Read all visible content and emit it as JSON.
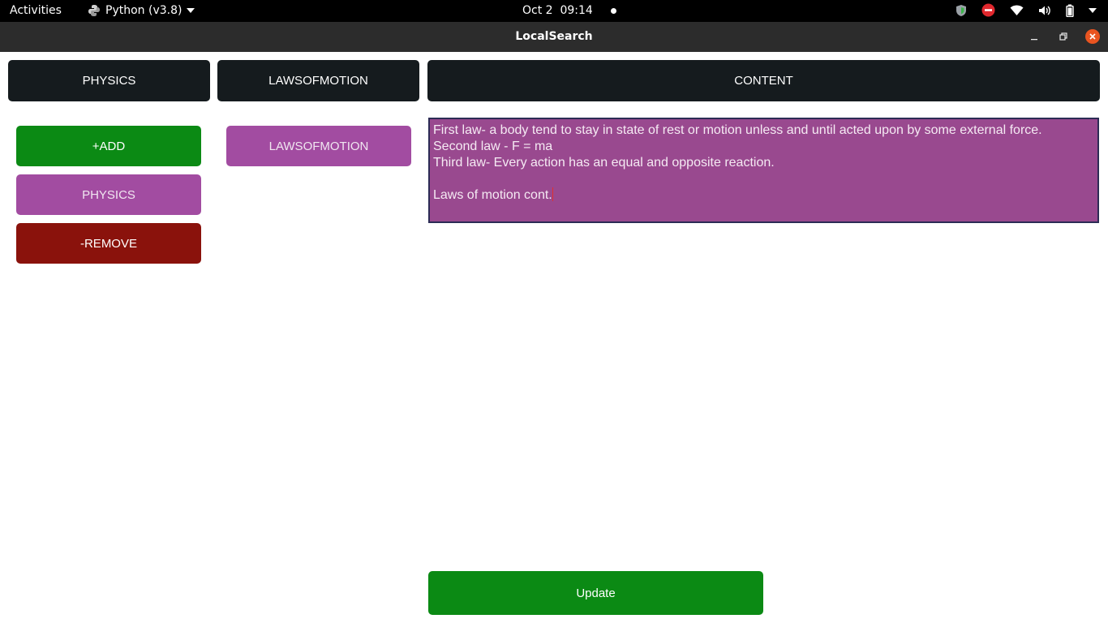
{
  "topbar": {
    "activities": "Activities",
    "app_menu": "Python (v3.8)",
    "date": "Oct 2",
    "time": "09:14"
  },
  "window": {
    "title": "LocalSearch"
  },
  "headers": {
    "col1": "PHYSICS",
    "col2": "LAWSOFMOTION",
    "col3": "CONTENT"
  },
  "left_column": {
    "add_label": "+ADD",
    "item_label": "PHYSICS",
    "remove_label": "-REMOVE"
  },
  "middle_column": {
    "item_label": "LAWSOFMOTION"
  },
  "content": {
    "lines": [
      "First law- a body tend to stay in state of rest or motion unless and until acted upon by some external force.",
      "Second law - F = ma",
      "Third law- Every action has an equal and opposite reaction.",
      "",
      "Laws of motion cont."
    ]
  },
  "update_label": "Update",
  "colors": {
    "green": "#0b8a14",
    "purple": "#a24ca1",
    "content_bg": "#99498f",
    "dark_red": "#8a120c",
    "header_bg": "#151b1e",
    "close_orange": "#e95420"
  }
}
